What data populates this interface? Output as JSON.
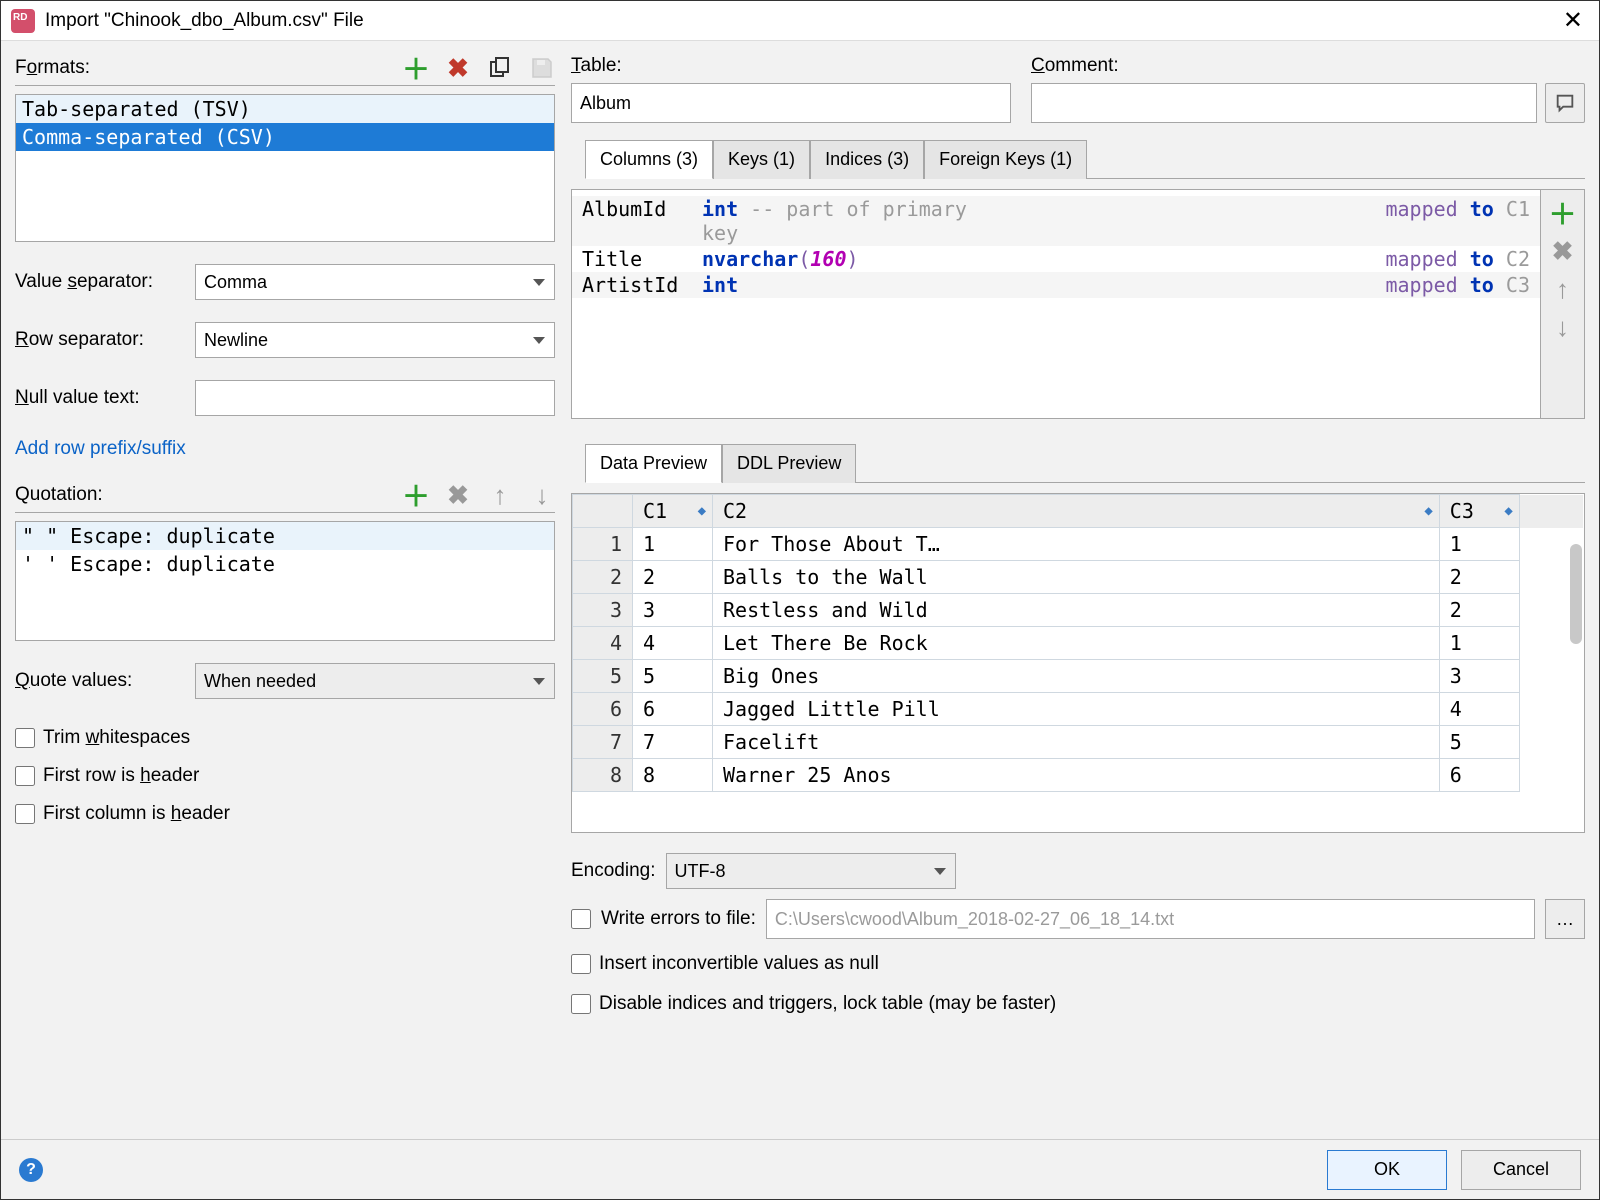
{
  "title": "Import \"Chinook_dbo_Album.csv\" File",
  "formats": {
    "label_prefix": "F",
    "label_underline": "o",
    "label_suffix": "rmats:",
    "items": [
      {
        "label": "Tab-separated (TSV)",
        "state": "hover"
      },
      {
        "label": "Comma-separated (CSV)",
        "state": "selected"
      }
    ]
  },
  "value_separator": {
    "label_prefix": "Value ",
    "label_underline": "s",
    "label_suffix": "eparator:",
    "value": "Comma"
  },
  "row_separator": {
    "label_underline": "R",
    "label_suffix": "ow separator:",
    "value": "Newline"
  },
  "null_value_text": {
    "label_underline": "N",
    "label_suffix": "ull value text:",
    "value": ""
  },
  "add_row_link": "Add row prefix/suffix",
  "quotation": {
    "label": "Quotation:",
    "rows": [
      {
        "q1": "\"",
        "q2": "\"",
        "esc": "Escape: duplicate",
        "sel": true
      },
      {
        "q1": "'",
        "q2": "'",
        "esc": "Escape: duplicate",
        "sel": false
      }
    ]
  },
  "quote_values": {
    "label_underline": "Q",
    "label_suffix": "uote values:",
    "value": "When needed"
  },
  "checks": {
    "trim": {
      "pre": "Trim ",
      "u": "w",
      "post": "hitespaces"
    },
    "first_row": {
      "pre": "First row is ",
      "u": "h",
      "post": "eader"
    },
    "first_col": {
      "pre": "First column is ",
      "u": "h",
      "post": "eader"
    }
  },
  "table": {
    "label_underline": "T",
    "label_suffix": "able:",
    "value": "Album"
  },
  "comment": {
    "label_underline": "C",
    "label_suffix": "omment:",
    "value": ""
  },
  "mapping_tabs": [
    "Columns (3)",
    "Keys (1)",
    "Indices (3)",
    "Foreign Keys (1)"
  ],
  "mapping_active": 0,
  "mapping_rows": [
    {
      "name": "AlbumId",
      "type_html": "int",
      "comment": "-- part of primary key",
      "right": "mapped to C1",
      "odd": true,
      "typelen": ""
    },
    {
      "name": "Title",
      "type_html": "nvarchar",
      "typelen": "160",
      "comment": "",
      "right": "mapped to C2",
      "odd": false
    },
    {
      "name": "ArtistId",
      "type_html": "int",
      "typelen": "",
      "comment": "",
      "right": "mapped to C3",
      "odd": true
    }
  ],
  "preview_tabs": [
    "Data Preview",
    "DDL Preview"
  ],
  "preview_active": 0,
  "preview_headers": [
    "C1",
    "C2",
    "C3"
  ],
  "preview_rows": [
    [
      "1",
      "For Those About T…",
      "1"
    ],
    [
      "2",
      "Balls to the Wall",
      "2"
    ],
    [
      "3",
      "Restless and Wild",
      "2"
    ],
    [
      "4",
      "Let There Be Rock",
      "1"
    ],
    [
      "5",
      "Big Ones",
      "3"
    ],
    [
      "6",
      "Jagged Little Pill",
      "4"
    ],
    [
      "7",
      "Facelift",
      "5"
    ],
    [
      "8",
      "Warner 25 Anos",
      "6"
    ]
  ],
  "encoding": {
    "label": "Encoding:",
    "value": "UTF-8"
  },
  "write_errors": {
    "label": "Write errors to file:",
    "path": "C:\\Users\\cwood\\Album_2018-02-27_06_18_14.txt"
  },
  "insert_null": "Insert inconvertible values as null",
  "disable_indices": "Disable indices and triggers, lock table (may be faster)",
  "buttons": {
    "ok": "OK",
    "cancel": "Cancel"
  }
}
